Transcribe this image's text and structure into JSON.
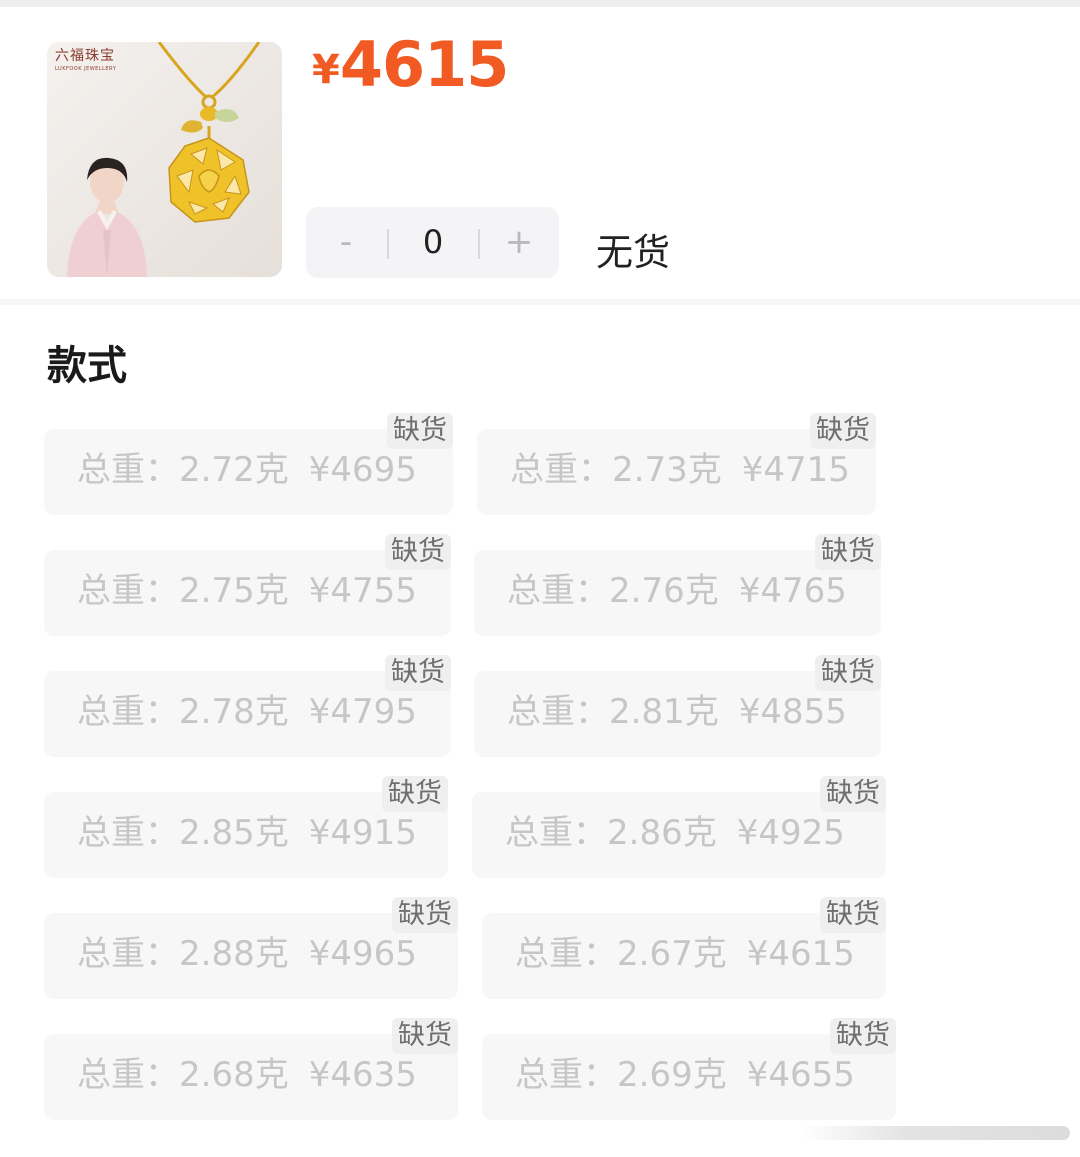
{
  "product": {
    "image_brand_cn": "六福珠宝",
    "image_brand_en": "LUKFOOK JEWELLERY",
    "price_symbol": "¥",
    "price_value": "4615"
  },
  "quantity": {
    "minus_label": "-",
    "value": "0",
    "plus_label": "+"
  },
  "stock_status": "无货",
  "section_title": "款式",
  "variants": [
    {
      "label": "总重：",
      "weight": "2.72克",
      "price": "¥4695",
      "tag": "缺货"
    },
    {
      "label": "总重：",
      "weight": "2.73克",
      "price": "¥4715",
      "tag": "缺货"
    },
    {
      "label": "总重：",
      "weight": "2.75克",
      "price": "¥4755",
      "tag": "缺货"
    },
    {
      "label": "总重：",
      "weight": "2.76克",
      "price": "¥4765",
      "tag": "缺货"
    },
    {
      "label": "总重：",
      "weight": "2.78克",
      "price": "¥4795",
      "tag": "缺货"
    },
    {
      "label": "总重：",
      "weight": "2.81克",
      "price": "¥4855",
      "tag": "缺货"
    },
    {
      "label": "总重：",
      "weight": "2.85克",
      "price": "¥4915",
      "tag": "缺货"
    },
    {
      "label": "总重：",
      "weight": "2.86克",
      "price": "¥4925",
      "tag": "缺货"
    },
    {
      "label": "总重：",
      "weight": "2.88克",
      "price": "¥4965",
      "tag": "缺货"
    },
    {
      "label": "总重：",
      "weight": "2.67克",
      "price": "¥4615",
      "tag": "缺货"
    },
    {
      "label": "总重：",
      "weight": "2.68克",
      "price": "¥4635",
      "tag": "缺货"
    },
    {
      "label": "总重：",
      "weight": "2.69克",
      "price": "¥4655",
      "tag": "缺货"
    }
  ],
  "colors": {
    "price": "#f15a22",
    "chip_background": "#f7f7f7",
    "chip_text_disabled": "#c6c6c6",
    "tag_background": "#efefef",
    "tag_text": "#6f6f6f"
  }
}
